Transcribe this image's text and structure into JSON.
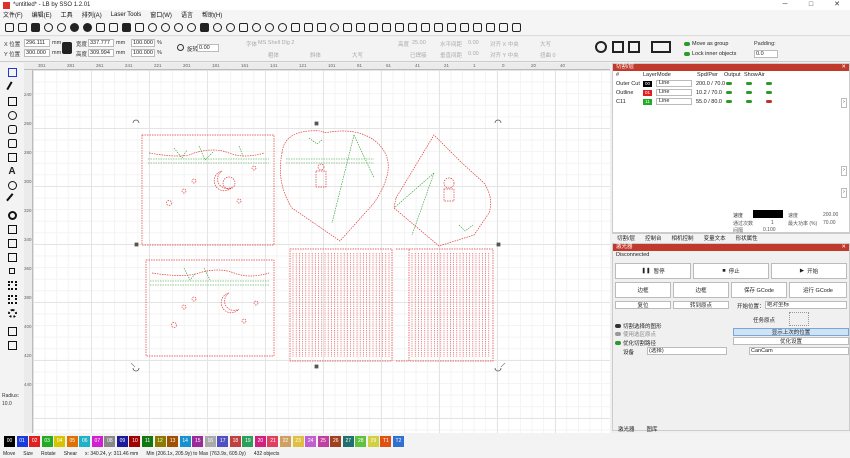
{
  "window": {
    "title": "*untitled* - LB by SSO 1.2.01",
    "min": "─",
    "max": "□",
    "close": "✕"
  },
  "menu": [
    "文件(F)",
    "编辑(E)",
    "工具",
    "排列(A)",
    "Laser Tools",
    "窗口(W)",
    "语言",
    "帮助(H)"
  ],
  "props": {
    "x_label": "X 位置",
    "x_value": "296.111",
    "y_label": "Y 位置",
    "y_value": "300.000",
    "unit": "mm",
    "w_label": "宽度",
    "w_value": "337.777",
    "h_label": "高度",
    "h_value": "309.994",
    "pct_w": "100.000",
    "pct_h": "100.000",
    "pct_sym": "%",
    "rot_label": "旋转",
    "rot_value": "0.00",
    "font_label": "字体",
    "font_value": "MS Shell Dlg 2",
    "size_label": "高度",
    "size_value": "25.00",
    "hspace_label": "水平间距",
    "hspace_value": "0.00",
    "vspace_label": "垂直间距",
    "vspace_value": "0.00",
    "align_h_label": "对齐 X 中央",
    "align_v_label": "对齐 Y 中央",
    "case_label": "大写",
    "bold_label": "粗体",
    "italic_label": "斜体",
    "upper_label": "大写",
    "weld_label": "已焊接",
    "distort_label": "扭曲 0",
    "move_group": "Move as group",
    "lock_objects": "Lock inner objects",
    "padding_label": "Padding:",
    "padding_value": "0.0"
  },
  "ruler_top": [
    "301",
    "281",
    "261",
    "241",
    "221",
    "201",
    "181",
    "161",
    "141",
    "121",
    "101",
    "81",
    "61",
    "41",
    "21",
    "1",
    "0",
    "20",
    "40"
  ],
  "ruler_left": [
    "240",
    "260",
    "280",
    "300",
    "320",
    "340",
    "360",
    "380",
    "400",
    "420",
    "440"
  ],
  "radius": {
    "label": "Radius:",
    "value": "10.0"
  },
  "layers": {
    "title": "切割/层",
    "headers": [
      "#",
      "Layer",
      "Mode",
      "Spd/Pwr",
      "Output",
      "Show",
      "Air"
    ],
    "rows": [
      {
        "name": "Outer Cut",
        "code": "00",
        "color": "#000000",
        "mode": "Line",
        "spd": "200.0 / 70.0"
      },
      {
        "name": "Outline",
        "code": "01",
        "color": "#e02020",
        "mode": "Line",
        "spd": "10.2 / 70.0"
      },
      {
        "name": "C11",
        "code": "11",
        "color": "#22aa22",
        "mode": "Line",
        "spd": "55.0 / 80.0"
      }
    ],
    "footer_speed_label": "速度",
    "footer_speed_value": "200.00",
    "footer_pass_label": "通过次数",
    "footer_pass_value": "1",
    "footer_power_label": "最大功率 (%)",
    "footer_power_value": "70.00",
    "footer_interval_label": "间隔",
    "footer_interval_value": "0.100"
  },
  "panel_tabs": [
    "切割/层",
    "控制台",
    "相机控制",
    "变量文本",
    "形状属性"
  ],
  "laser": {
    "title": "激光器",
    "status": "Disconnected",
    "pause": "暂停",
    "stop": "停止",
    "start": "开始",
    "frame": "边框",
    "outline": "边框",
    "save_gcode": "保存 GCode",
    "run_gcode": "运行 GCode",
    "home": "复位",
    "goto_origin": "转到原点",
    "start_from_label": "开始位置：",
    "start_from_value": "绝对坐标",
    "job_origin_label": "任务原点",
    "cut_selected": "切割选择的图形",
    "use_selection_origin": "使用选区原点",
    "optimize": "优化切割路径",
    "show_last_position": "显示上次的位置",
    "optimize_settings": "优化设置",
    "device_label": "设备",
    "device_value": "(选择)",
    "camera_value": "CanCam"
  },
  "bottom_tabs": [
    "激光器",
    "图库"
  ],
  "palette": [
    {
      "code": "00",
      "color": "#000000"
    },
    {
      "code": "01",
      "color": "#1a3adb"
    },
    {
      "code": "02",
      "color": "#e02020"
    },
    {
      "code": "03",
      "color": "#22aa22"
    },
    {
      "code": "04",
      "color": "#d6c400"
    },
    {
      "code": "05",
      "color": "#e07000"
    },
    {
      "code": "06",
      "color": "#20b0c8"
    },
    {
      "code": "07",
      "color": "#d020d0"
    },
    {
      "code": "08",
      "color": "#888888"
    },
    {
      "code": "09",
      "color": "#1a1a9a"
    },
    {
      "code": "10",
      "color": "#a00000"
    },
    {
      "code": "11",
      "color": "#117711"
    },
    {
      "code": "12",
      "color": "#8a7a00"
    },
    {
      "code": "13",
      "color": "#a05000"
    },
    {
      "code": "14",
      "color": "#1890d0"
    },
    {
      "code": "15",
      "color": "#9a2a9a"
    },
    {
      "code": "16",
      "color": "#aaaaaa"
    },
    {
      "code": "17",
      "color": "#5050c0"
    },
    {
      "code": "18",
      "color": "#c04040"
    },
    {
      "code": "19",
      "color": "#2aa05a"
    },
    {
      "code": "20",
      "color": "#d02080"
    },
    {
      "code": "21",
      "color": "#e04060"
    },
    {
      "code": "22",
      "color": "#d0a060"
    },
    {
      "code": "23",
      "color": "#e0c040"
    },
    {
      "code": "24",
      "color": "#c060d0"
    },
    {
      "code": "25",
      "color": "#c040a0"
    },
    {
      "code": "26",
      "color": "#a04020"
    },
    {
      "code": "27",
      "color": "#207070"
    },
    {
      "code": "28",
      "color": "#60c040"
    },
    {
      "code": "29",
      "color": "#d0d040"
    },
    {
      "code": "T1",
      "color": "#e05010"
    },
    {
      "code": "T2",
      "color": "#3070d0"
    }
  ],
  "status": {
    "move": "Move",
    "size": "Size",
    "rotate": "Rotate",
    "shear": "Shear",
    "coords": "x: 340.24, y: 311.46 mm",
    "bounds": "Min (206.1x, 205.9y) to Max (763.9x, 605.0y)",
    "objects": "432 objects"
  }
}
